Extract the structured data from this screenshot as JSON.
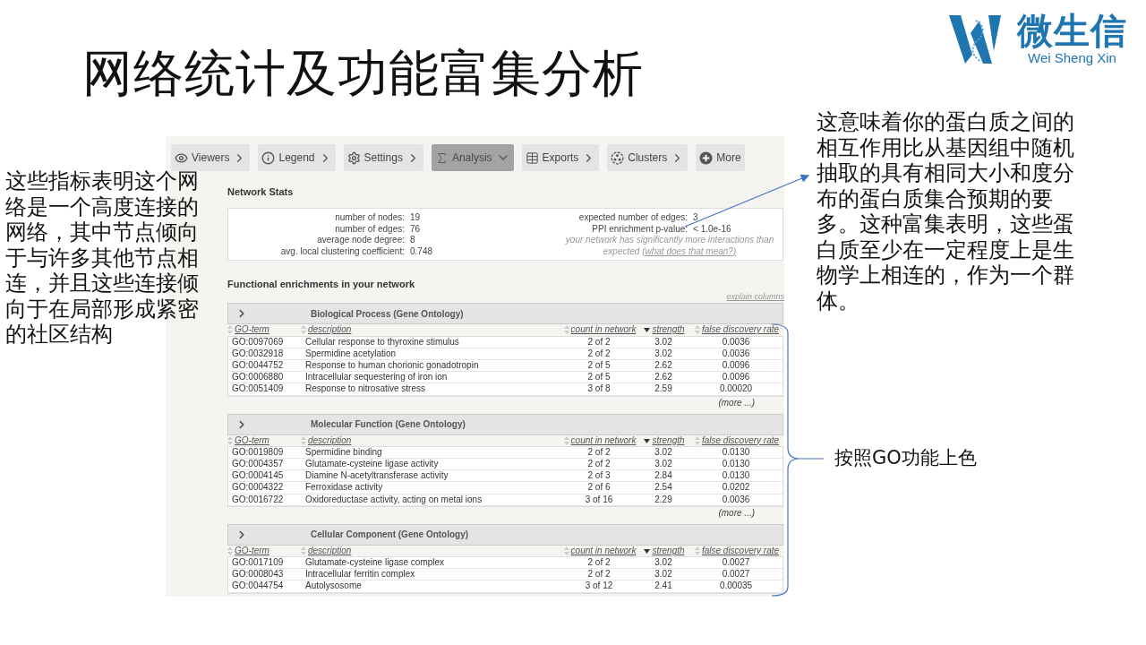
{
  "title": "网络统计及功能富集分析",
  "logo": {
    "name": "微生信",
    "subtitle": "Wei Sheng Xin"
  },
  "left_note": "这些指标表明这个网络是一个高度连接的网络，其中节点倾向于与许多其他节点相连，并且这些连接倾向于在局部形成紧密的社区结构",
  "right_note": "这意味着你的蛋白质之间的相互作用比从基因组中随机抽取的具有相同大小和度分布的蛋白质集合预期的要多。这种富集表明，这些蛋白质至少在一定程度上是生物学上相连的，作为一个群体。",
  "bracket_note": "按照GO功能上色",
  "screenshot": {
    "toolbar": [
      {
        "label": "Viewers",
        "selected": false
      },
      {
        "label": "Legend",
        "selected": false
      },
      {
        "label": "Settings",
        "selected": false
      },
      {
        "label": "Analysis",
        "selected": true
      },
      {
        "label": "Exports",
        "selected": false
      },
      {
        "label": "Clusters",
        "selected": false
      },
      {
        "label": "More",
        "selected": false
      }
    ],
    "stats": {
      "heading": "Network Stats",
      "left": [
        {
          "label": "number of nodes:",
          "value": "19"
        },
        {
          "label": "number of edges:",
          "value": "76"
        },
        {
          "label": "average node degree:",
          "value": "8"
        },
        {
          "label": "avg. local clustering coefficient:",
          "value": "0.748"
        }
      ],
      "right": [
        {
          "label": "expected number of edges:",
          "value": "3"
        },
        {
          "label": "PPI enrichment p-value:",
          "value": "< 1.0e-16"
        }
      ],
      "note": "your network has significantly more interactions than expected",
      "note_link": "(what does that mean?)"
    },
    "enrichment_heading": "Functional enrichments in your network",
    "explain_link": "explain columns",
    "sections": [
      {
        "title": "Biological Process (Gene Ontology)",
        "expanded": false,
        "columns": [
          {
            "label": "GO-term",
            "sorted": false
          },
          {
            "label": "description",
            "sorted": false
          },
          {
            "label": "count in network",
            "sorted": false
          },
          {
            "label": "strength",
            "sorted": true
          },
          {
            "label": "false discovery rate",
            "sorted": false
          }
        ],
        "rows": [
          [
            "GO:0097069",
            "Cellular response to thyroxine stimulus",
            "2 of 2",
            "3.02",
            "0.0036"
          ],
          [
            "GO:0032918",
            "Spermidine acetylation",
            "2 of 2",
            "3.02",
            "0.0036"
          ],
          [
            "GO:0044752",
            "Response to human chorionic gonadotropin",
            "2 of 5",
            "2.62",
            "0.0096"
          ],
          [
            "GO:0006880",
            "Intracellular sequestering of iron ion",
            "2 of 5",
            "2.62",
            "0.0096"
          ],
          [
            "GO:0051409",
            "Response to nitrosative stress",
            "3 of 8",
            "2.59",
            "0.00020"
          ]
        ],
        "more": "(more ...)"
      },
      {
        "title": "Molecular Function (Gene Ontology)",
        "expanded": false,
        "columns": [
          {
            "label": "GO-term",
            "sorted": false
          },
          {
            "label": "description",
            "sorted": false
          },
          {
            "label": "count in network",
            "sorted": false
          },
          {
            "label": "strength",
            "sorted": true
          },
          {
            "label": "false discovery rate",
            "sorted": false
          }
        ],
        "rows": [
          [
            "GO:0019809",
            "Spermidine binding",
            "2 of 2",
            "3.02",
            "0.0130"
          ],
          [
            "GO:0004357",
            "Glutamate-cysteine ligase activity",
            "2 of 2",
            "3.02",
            "0.0130"
          ],
          [
            "GO:0004145",
            "Diamine N-acetyltransferase activity",
            "2 of 3",
            "2.84",
            "0.0130"
          ],
          [
            "GO:0004322",
            "Ferroxidase activity",
            "2 of 6",
            "2.54",
            "0.0202"
          ],
          [
            "GO:0016722",
            "Oxidoreductase activity, acting on metal ions",
            "3 of 16",
            "2.29",
            "0.0036"
          ]
        ],
        "more": "(more ...)"
      },
      {
        "title": "Cellular Component (Gene Ontology)",
        "expanded": false,
        "columns": [
          {
            "label": "GO-term",
            "sorted": false
          },
          {
            "label": "description",
            "sorted": false
          },
          {
            "label": "count in network",
            "sorted": false
          },
          {
            "label": "strength",
            "sorted": true
          },
          {
            "label": "false discovery rate",
            "sorted": false
          }
        ],
        "rows": [
          [
            "GO:0017109",
            "Glutamate-cysteine ligase complex",
            "2 of 2",
            "3.02",
            "0.0027"
          ],
          [
            "GO:0008043",
            "Intracellular ferritin complex",
            "2 of 2",
            "3.02",
            "0.0027"
          ],
          [
            "GO:0044754",
            "Autolysosome",
            "3 of 12",
            "2.41",
            "0.00035"
          ]
        ]
      }
    ]
  }
}
